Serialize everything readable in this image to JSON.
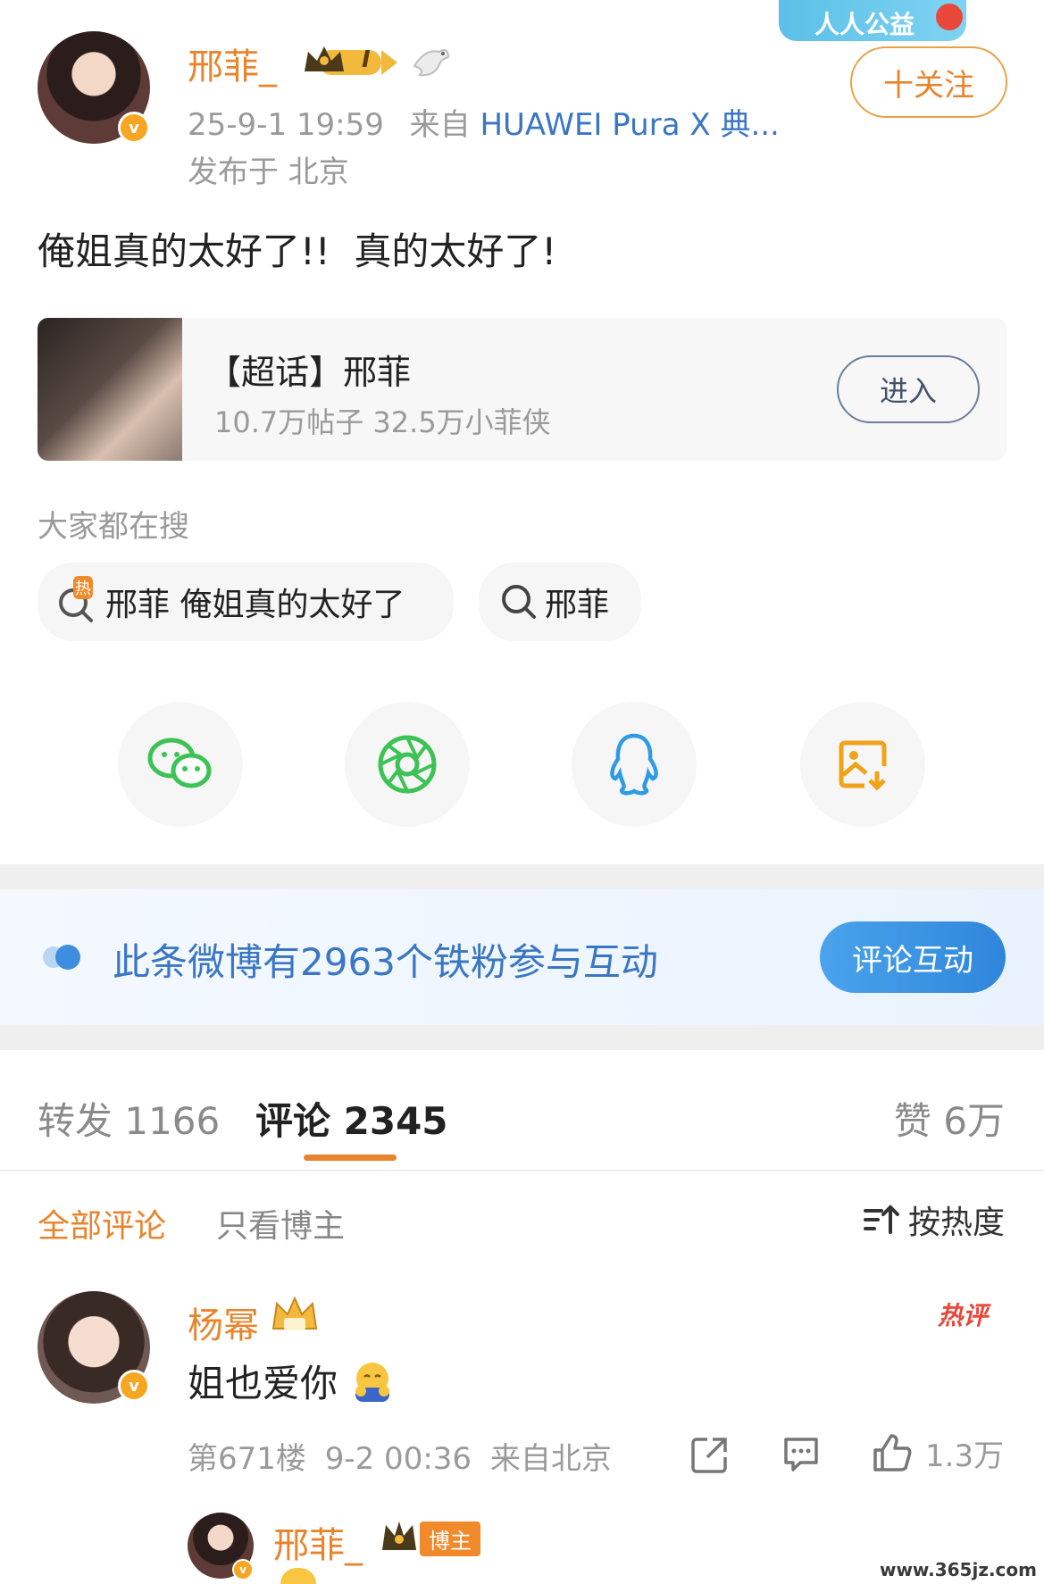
{
  "post": {
    "author": "邢菲_",
    "level_badge": "I",
    "time": "25-9-1 19:59",
    "source_prefix": "来自",
    "source_device": "HUAWEI Pura X 典...",
    "location": "发布于 北京",
    "follow_label": "十关注",
    "charity_badge": "人人公益",
    "content": "俺姐真的太好了!!  真的太好了!"
  },
  "topic_card": {
    "title": "【超话】邢菲",
    "stats": "10.7万帖子 32.5万小菲侠",
    "enter_label": "进入"
  },
  "search": {
    "section_title": "大家都在搜",
    "hot_badge": "热",
    "items": [
      "邢菲 俺姐真的太好了",
      "邢菲"
    ]
  },
  "share": {
    "icons": [
      "wechat-icon",
      "moments-icon",
      "qq-icon",
      "save-image-icon"
    ]
  },
  "fans_banner": {
    "text": "此条微博有2963个铁粉参与互动",
    "button": "评论互动"
  },
  "tabs": {
    "repost": "转发 1166",
    "comments": "评论 2345",
    "likes": "赞 6万"
  },
  "filters": {
    "all": "全部评论",
    "author_only": "只看博主",
    "sort": "按热度"
  },
  "comment": {
    "user": "杨幂",
    "hot_tag": "热评",
    "text": "姐也爱你",
    "floor": "第671楼",
    "time": "9-2 00:36",
    "from": "来自北京",
    "like_count": "1.3万"
  },
  "reply": {
    "user": "邢菲_",
    "tag": "博主"
  },
  "watermark": "www.365jz.com",
  "colors": {
    "accent": "#e8842c",
    "link_blue": "#3a76c4",
    "button_blue": "#3d8ee0"
  }
}
